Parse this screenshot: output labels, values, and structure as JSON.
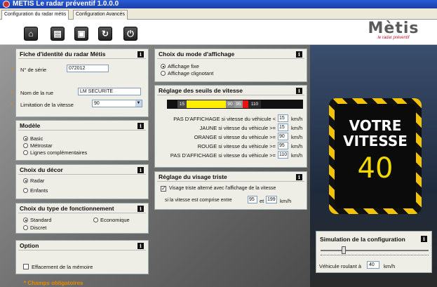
{
  "window": {
    "title": "METIS Le radar préventif 1.0.0.0"
  },
  "tabs": [
    "Configuration du radar métis",
    "Configuration Avancés"
  ],
  "toolbar": {
    "buttons": [
      "home-icon",
      "folder-icon",
      "save-icon",
      "refresh-icon",
      "power-icon"
    ]
  },
  "logo": {
    "brand": "Mètis",
    "tagline": "le radar préventif"
  },
  "info_glyph": "i",
  "identity": {
    "title": "Fiche d'identité du radar Métis",
    "serial_label": "N° de série",
    "serial_value": "072012",
    "street_label": "Nom de la rue",
    "street_value": "LM SECURITE",
    "limit_label": "Limitation de la vitesse",
    "limit_value": "90"
  },
  "modele": {
    "title": "Modèle",
    "options": [
      "Basic",
      "Métrostar",
      "Lignes complémentaires"
    ]
  },
  "decor": {
    "title": "Choix du décor",
    "options": [
      "Radar",
      "Enfants"
    ]
  },
  "fonctionnement": {
    "title": "Choix du type de fonctionnement",
    "options": [
      "Standard",
      "Economique",
      "Discret"
    ]
  },
  "option": {
    "title": "Option",
    "memory_label": "Effacement de la mémoire"
  },
  "required_note": "* Champs obligatoires",
  "affichage": {
    "title": "Choix du mode d'affichage",
    "options": [
      "Affichage fixe",
      "Affichage clignotant"
    ]
  },
  "seuils": {
    "title": "Réglage des seuils de vitesse",
    "bar": [
      {
        "label": "15",
        "color": "#4a4a4a"
      },
      {
        "label": "",
        "color": "#ffee00"
      },
      {
        "label": "90",
        "color": "#8a8a8a"
      },
      {
        "label": "95",
        "color": "#999999"
      },
      {
        "label": "",
        "color": "#ee1111"
      },
      {
        "label": "110",
        "color": "#2a2a2a"
      }
    ],
    "rows": [
      {
        "label": "PAS D'AFFICHAGE si vitesse du véhicule <",
        "value": "15",
        "unit": "km/h"
      },
      {
        "label": "JAUNE si vitesse du véhicule >=",
        "value": "15",
        "unit": "km/h"
      },
      {
        "label": "ORANGE si vitesse du véhicule >=",
        "value": "90",
        "unit": "km/h"
      },
      {
        "label": "ROUGE si vitesse du véhicule >=",
        "value": "95",
        "unit": "km/h"
      },
      {
        "label": "PAS D'AFFICHAGE si vitesse du véhicule >=",
        "value": "110",
        "unit": "km/h"
      }
    ]
  },
  "visage": {
    "title": "Réglage du visage triste",
    "checkbox_label": "Visage triste alterné avec l'affichage de la vitesse",
    "range_prefix": "si la vitesse est comprise entre",
    "from": "95",
    "and": "et",
    "to": "199",
    "unit": "km/h"
  },
  "sign": {
    "line1": "VOTRE",
    "line2": "VITESSE",
    "speed": "40"
  },
  "simulation": {
    "title": "Simulation de la configuration",
    "slider_fraction": 0.2,
    "vehicle_label": "Véhicule roulant à",
    "vehicle_value": "40",
    "unit": "km/h"
  }
}
